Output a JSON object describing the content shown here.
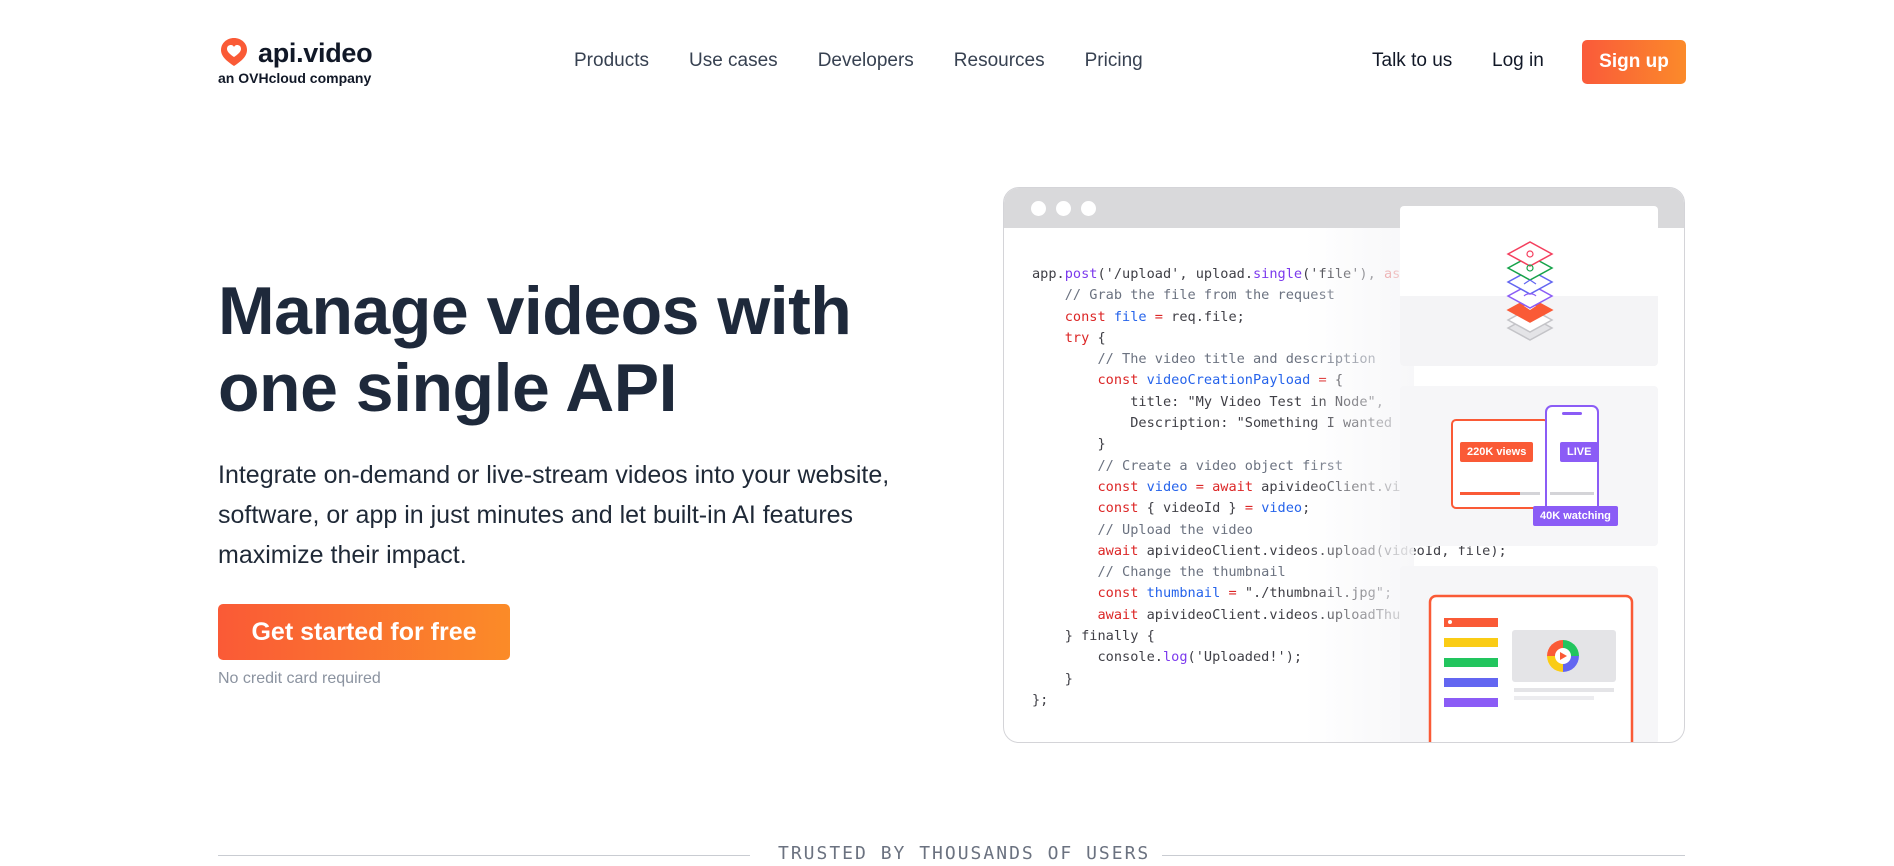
{
  "brand": {
    "name": "api.video",
    "tagline": "an OVHcloud company",
    "accent": "#fa5a36",
    "accent_end": "#fb8b28"
  },
  "nav": {
    "items": [
      {
        "label": "Products"
      },
      {
        "label": "Use cases"
      },
      {
        "label": "Developers"
      },
      {
        "label": "Resources"
      },
      {
        "label": "Pricing"
      }
    ],
    "talk": "Talk to us",
    "login": "Log in",
    "signup": "Sign up"
  },
  "hero": {
    "title_line1": "Manage videos with",
    "title_line2": "one single API",
    "description": "Integrate on-demand or live-stream videos into your website, software, or app in just minutes and let built-in AI features maximize their impact.",
    "cta": "Get started for free",
    "note": "No credit card required"
  },
  "illustration": {
    "views_badge": "220K views",
    "live_badge": "LIVE",
    "watching_badge": "40K watching"
  },
  "trusted": "TRUSTED BY THOUSANDS OF USERS"
}
